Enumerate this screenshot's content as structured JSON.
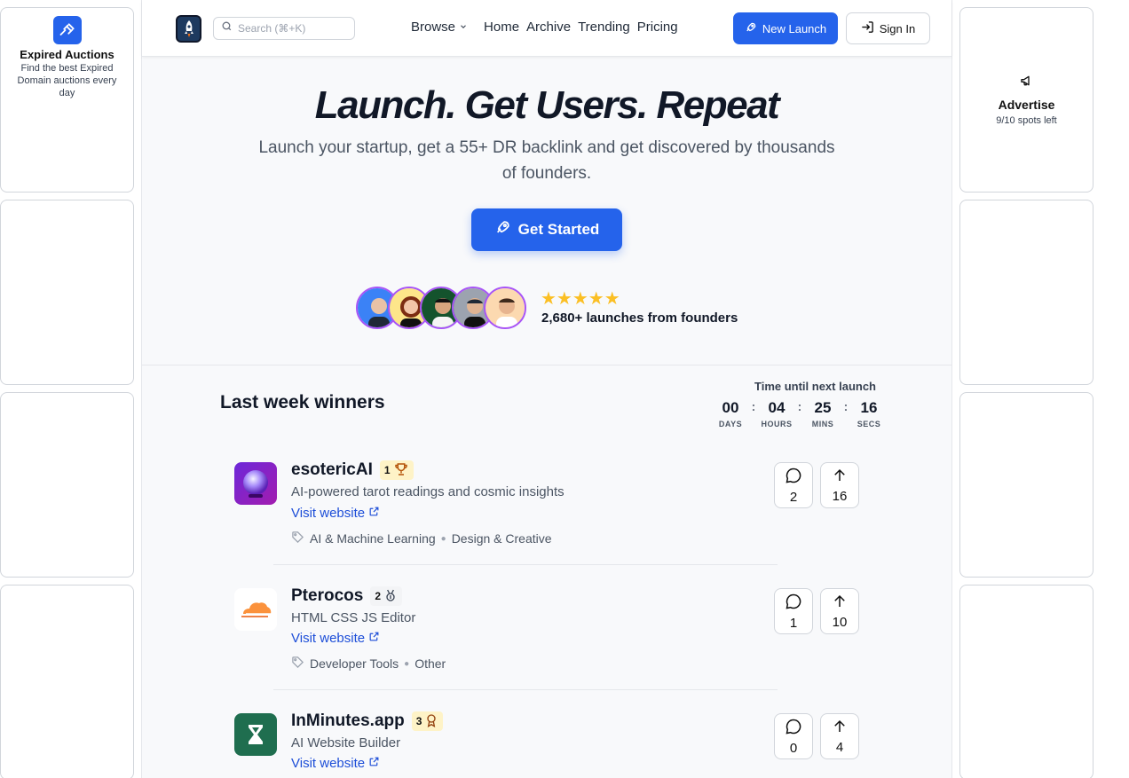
{
  "left_ad": {
    "title": "Expired Auctions",
    "description": "Find the best Expired Domain auctions every day"
  },
  "right_ad": {
    "title": "Advertise",
    "spots": "9/10 spots left"
  },
  "header": {
    "search_placeholder": "Search (⌘+K)",
    "nav": [
      "Browse",
      "Home",
      "Archive",
      "Trending",
      "Pricing"
    ],
    "new_launch": "New Launch",
    "sign_in": "Sign In"
  },
  "hero": {
    "title": "Launch. Get Users. Repeat",
    "subtitle": "Launch your startup, get a 55+ DR backlink and get discovered by thousands of founders.",
    "cta": "Get Started",
    "stars": "★★★★★",
    "launch_count": "2,680+ launches from founders"
  },
  "winners": {
    "heading": "Last week winners",
    "countdown_label": "Time until next launch",
    "countdown": [
      {
        "value": "00",
        "label": "DAYS"
      },
      {
        "value": "04",
        "label": "HOURS"
      },
      {
        "value": "25",
        "label": "MINS"
      },
      {
        "value": "16",
        "label": "SECS"
      }
    ],
    "countdown_sep": ":",
    "visit_label": "Visit website",
    "products": [
      {
        "name": "esotericAI",
        "rank": "1",
        "description": "AI-powered tarot readings and cosmic insights",
        "tags": [
          "AI & Machine Learning",
          "Design & Creative"
        ],
        "comments": "2",
        "upvotes": "16"
      },
      {
        "name": "Pterocos",
        "rank": "2",
        "description": "HTML CSS JS Editor",
        "tags": [
          "Developer Tools",
          "Other"
        ],
        "comments": "1",
        "upvotes": "10"
      },
      {
        "name": "InMinutes.app",
        "rank": "3",
        "description": "AI Website Builder",
        "tags": [],
        "comments": "0",
        "upvotes": "4"
      }
    ]
  },
  "colors": {
    "accent": "#2563eb",
    "star": "#fbbf24",
    "link": "#1d4ed8"
  }
}
